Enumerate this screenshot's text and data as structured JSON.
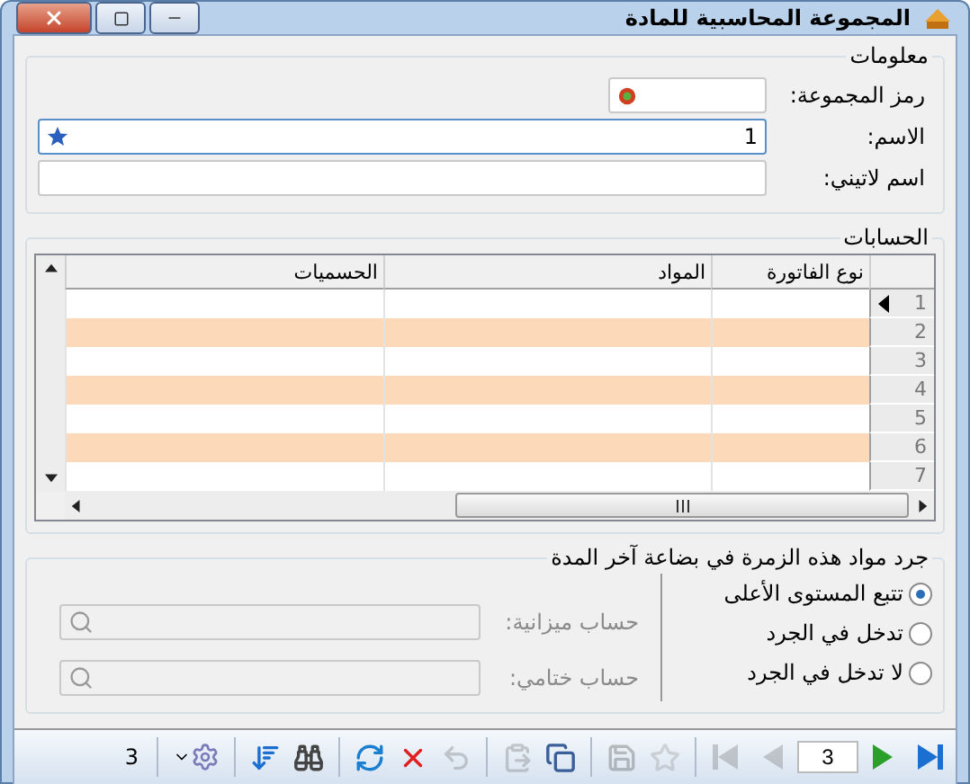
{
  "window": {
    "title": "المجموعة المحاسبية للمادة"
  },
  "info": {
    "legend": "معلومات",
    "fields": [
      {
        "kind": "code",
        "label": "رمز المجموعة:"
      },
      {
        "kind": "name",
        "label": "الاسم:",
        "value": "1",
        "focused": true
      },
      {
        "kind": "text",
        "label": "اسم لاتيني:",
        "focused": false
      }
    ]
  },
  "accounts": {
    "legend": "الحسابات",
    "columns": [
      "نوع الفاتورة",
      "المواد",
      "الحسميات"
    ],
    "rows": [
      {
        "number": "1",
        "selected": true
      },
      {
        "number": "2",
        "selected": false
      },
      {
        "number": "3",
        "selected": false
      },
      {
        "number": "4",
        "selected": false
      },
      {
        "number": "5",
        "selected": false
      },
      {
        "number": "6",
        "selected": false
      },
      {
        "number": "7",
        "selected": false
      }
    ]
  },
  "inventory": {
    "legend": "جرد مواد هذه الزمرة في بضاعة آخر المدة",
    "options": [
      {
        "label": "تتبع المستوى الأعلى",
        "selected": true
      },
      {
        "label": "تدخل في الجرد",
        "selected": false
      },
      {
        "label": "لا تدخل في الجرد",
        "selected": false
      }
    ],
    "lookups": [
      {
        "label": "حساب ميزانية:",
        "disabled": true
      },
      {
        "label": "حساب ختامي:",
        "disabled": true
      }
    ]
  },
  "toolbar": {
    "items": [
      {
        "kind": "end",
        "disabled": false
      },
      {
        "kind": "next",
        "disabled": false
      },
      {
        "kind": "page",
        "value": "3"
      },
      {
        "kind": "prev",
        "disabled": true
      },
      {
        "kind": "start",
        "disabled": true
      },
      {
        "kind": "sep"
      },
      {
        "kind": "star",
        "disabled": true
      },
      {
        "kind": "save",
        "disabled": true
      },
      {
        "kind": "sep"
      },
      {
        "kind": "copy",
        "disabled": false
      },
      {
        "kind": "paste",
        "disabled": true
      },
      {
        "kind": "sep"
      },
      {
        "kind": "undo",
        "disabled": true
      },
      {
        "kind": "delete",
        "disabled": false
      },
      {
        "kind": "refresh",
        "disabled": false
      },
      {
        "kind": "sep"
      },
      {
        "kind": "find",
        "disabled": false
      },
      {
        "kind": "sort",
        "disabled": false
      },
      {
        "kind": "sep"
      },
      {
        "kind": "settings",
        "disabled": false
      },
      {
        "kind": "sep"
      },
      {
        "kind": "count",
        "text": "3"
      }
    ]
  }
}
